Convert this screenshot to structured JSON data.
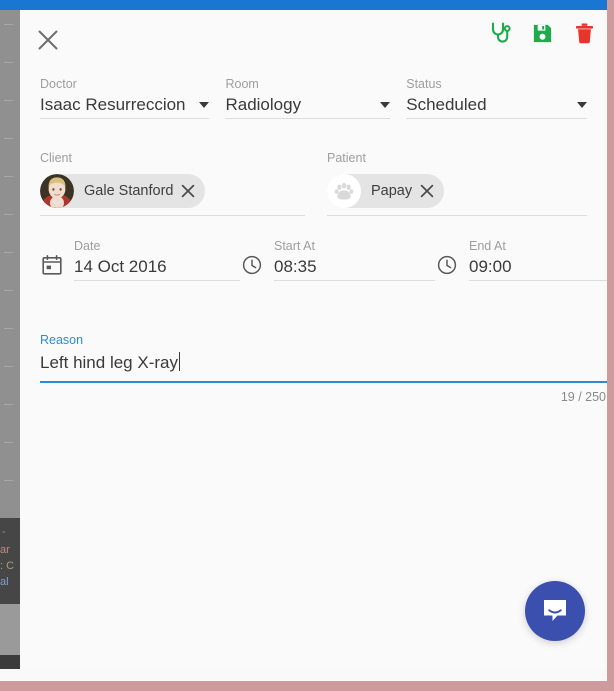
{
  "window": {
    "app_bar_color": "#1976d2",
    "frame_border_color": "#cf9a9c",
    "modal_background": "#fafafa"
  },
  "background": {
    "dark_panel_fragments": [
      "-",
      "ar",
      ": C",
      "al"
    ]
  },
  "toolbar": {
    "close_label": "close",
    "actions": [
      {
        "name": "consultation",
        "icon": "stethoscope-icon",
        "color": "#1faa4b"
      },
      {
        "name": "save",
        "icon": "save-icon",
        "color": "#1faa4b"
      },
      {
        "name": "delete",
        "icon": "trash-icon",
        "color": "#e8352c"
      }
    ]
  },
  "form": {
    "doctor": {
      "label": "Doctor",
      "value": "Isaac Resurreccion"
    },
    "room": {
      "label": "Room",
      "value": "Radiology"
    },
    "status": {
      "label": "Status",
      "value": "Scheduled"
    },
    "client": {
      "label": "Client",
      "chip": {
        "name": "Gale Stanford",
        "avatar": "client-photo-avatar",
        "remove_label": "remove"
      }
    },
    "patient": {
      "label": "Patient",
      "chip": {
        "name": "Papay",
        "avatar": "paw-avatar",
        "remove_label": "remove"
      }
    },
    "date": {
      "label": "Date",
      "value": "14 Oct 2016",
      "icon": "calendar-icon"
    },
    "start_at": {
      "label": "Start At",
      "value": "08:35",
      "icon": "clock-icon"
    },
    "end_at": {
      "label": "End At",
      "value": "09:00",
      "icon": "clock-icon"
    },
    "reason": {
      "label": "Reason",
      "value": "Left hind leg X-ray",
      "focused": true,
      "char_count": "19 / 250",
      "accent_color": "#2d8bd4"
    }
  },
  "intercom": {
    "label": "Open Intercom Messenger",
    "color": "#3b4fae"
  }
}
